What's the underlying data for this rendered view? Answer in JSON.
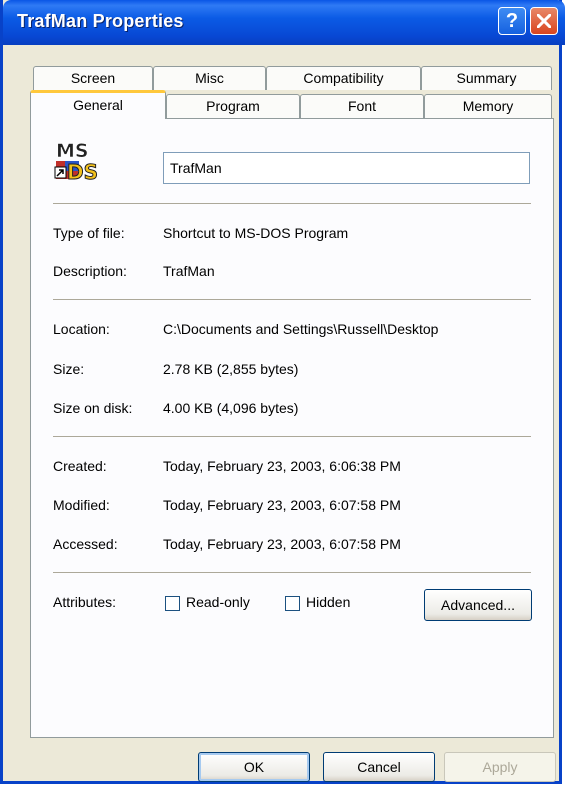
{
  "window": {
    "title": "TrafMan Properties"
  },
  "tabs": {
    "back": [
      "Screen",
      "Misc",
      "Compatibility",
      "Summary"
    ],
    "front": [
      "General",
      "Program",
      "Font",
      "Memory"
    ]
  },
  "general": {
    "icon": "ms-dos-icon",
    "name_value": "TrafMan",
    "type_label": "Type of file:",
    "type_value": "Shortcut to MS-DOS Program",
    "description_label": "Description:",
    "description_value": "TrafMan",
    "location_label": "Location:",
    "location_value": "C:\\Documents and Settings\\Russell\\Desktop",
    "size_label": "Size:",
    "size_value": "2.78 KB (2,855 bytes)",
    "size_on_disk_label": "Size on disk:",
    "size_on_disk_value": "4.00 KB (4,096 bytes)",
    "created_label": "Created:",
    "created_value": "Today, February 23, 2003, 6:06:38 PM",
    "modified_label": "Modified:",
    "modified_value": "Today, February 23, 2003, 6:07:58 PM",
    "accessed_label": "Accessed:",
    "accessed_value": "Today, February 23, 2003, 6:07:58 PM",
    "attributes_label": "Attributes:",
    "readonly_label": "Read-only",
    "hidden_label": "Hidden",
    "advanced_label": "Advanced..."
  },
  "buttons": {
    "ok": "OK",
    "cancel": "Cancel",
    "apply": "Apply"
  }
}
